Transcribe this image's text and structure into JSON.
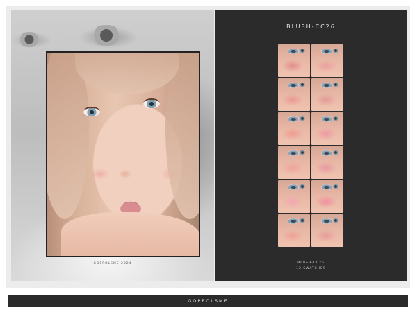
{
  "right_panel": {
    "title": "BLUSH-CC26",
    "caption_line1": "BLUSH-CC26",
    "caption_line2": "12 SWATCHES"
  },
  "left_panel": {
    "caption": "GOPPOLSME 2024"
  },
  "swatches": [
    {
      "blush_color": "#e08f8c"
    },
    {
      "blush_color": "#e9a0a0"
    },
    {
      "blush_color": "#ea9b93"
    },
    {
      "blush_color": "#e29a98"
    },
    {
      "blush_color": "#ee9d8f"
    },
    {
      "blush_color": "#ee9aa5"
    },
    {
      "blush_color": "#f0a39d"
    },
    {
      "blush_color": "#e799a2"
    },
    {
      "blush_color": "#f3a8b3"
    },
    {
      "blush_color": "#f08fa0"
    },
    {
      "blush_color": "#eea197"
    },
    {
      "blush_color": "#e69b9a"
    }
  ],
  "footer": {
    "label": "GOPPOLSME"
  }
}
